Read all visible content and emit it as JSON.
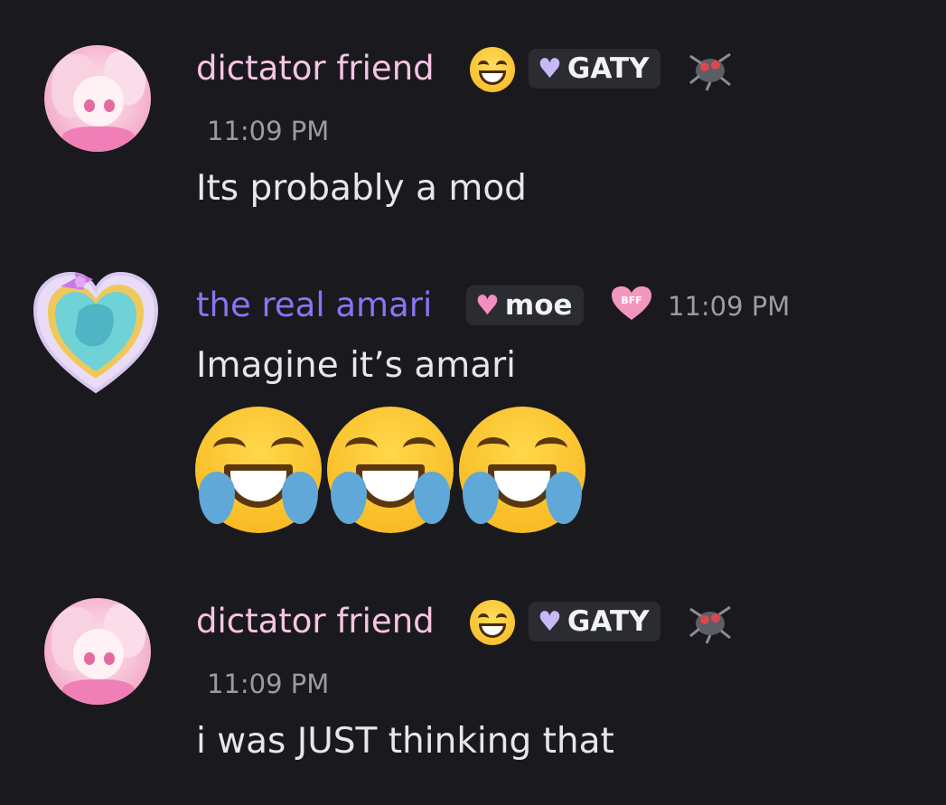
{
  "messages": [
    {
      "username": "dictator friend",
      "username_color": "#f6c5e3",
      "role_tag": "GATY",
      "role_icon": "lavender-heart",
      "timestamp": "11:09 PM",
      "text": "Its probably a mod"
    },
    {
      "username": "the real amari",
      "username_color": "#8b73f2",
      "role_tag": "moe",
      "role_icon": "pink-heart",
      "badge": "BFF",
      "timestamp": "11:09 PM",
      "text": "Imagine it’s amari",
      "emojis": [
        "face-with-tears-of-joy",
        "face-with-tears-of-joy",
        "face-with-tears-of-joy"
      ]
    },
    {
      "username": "dictator friend",
      "username_color": "#f6c5e3",
      "role_tag": "GATY",
      "role_icon": "lavender-heart",
      "timestamp": "11:09 PM",
      "text": "i was JUST thinking that"
    }
  ],
  "theme": {
    "background": "#1a1a1e",
    "tag_background": "#2b2c31",
    "timestamp_color": "#9a9ca3"
  }
}
